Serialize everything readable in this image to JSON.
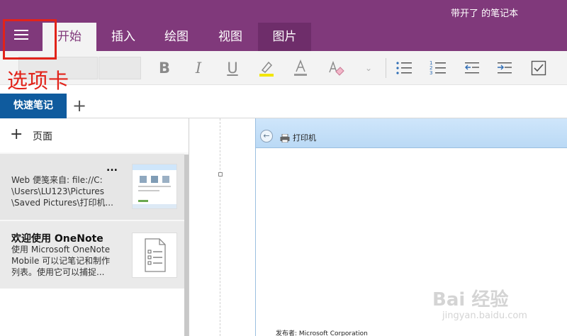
{
  "window": {
    "title": "带开了 的笔记本"
  },
  "tabs": [
    {
      "label": "开始",
      "active": true
    },
    {
      "label": "插入"
    },
    {
      "label": "绘图"
    },
    {
      "label": "视图"
    },
    {
      "label": "图片",
      "highlight": true
    }
  ],
  "ribbon": {
    "bold": "B",
    "italic": "I",
    "underline": "U",
    "font_color": "A",
    "highlight_color": "#f2e600",
    "icons": [
      "bold-icon",
      "italic-icon",
      "underline-icon",
      "highlight-icon",
      "font-color-icon",
      "clear-format-icon",
      "dropdown-icon",
      "bullet-list-icon",
      "numbered-list-icon",
      "outdent-icon",
      "indent-icon",
      "todo-checkbox-icon"
    ]
  },
  "annotation": "选项卡",
  "sections": {
    "active": "快速笔记",
    "add": "+"
  },
  "pages": {
    "add_label": "页面",
    "items": [
      {
        "title": "...",
        "body": [
          "Web 便笺来自: file://C:",
          "\\Users\\LU123\\Pictures",
          "\\Saved Pictures\\打印机..."
        ]
      },
      {
        "title": "欢迎使用 OneNote",
        "body": [
          "使用 Microsoft OneNote",
          "Mobile 可以记笔记和制作",
          "列表。使用它可以捕捉..."
        ]
      }
    ]
  },
  "canvas": {
    "embedded_title": "打印机",
    "publisher": "发布者: Microsoft Corporation"
  },
  "watermark": {
    "main": "Bai 经验",
    "sub": "jingyan.baidu.com"
  },
  "colors": {
    "brand": "#80397b",
    "section": "#0f5b9e",
    "annotation": "#e2231a"
  }
}
